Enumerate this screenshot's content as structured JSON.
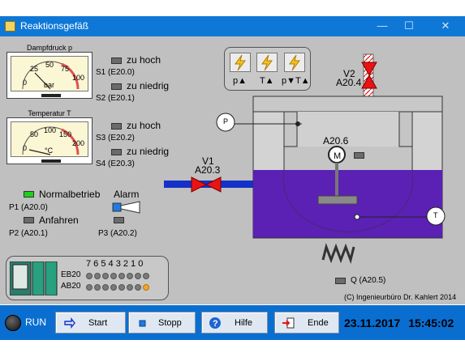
{
  "window": {
    "title": "Reaktionsgefäß",
    "controls": [
      "—",
      "☐",
      "✕"
    ]
  },
  "gauges": {
    "pressure": {
      "caption": "Dampfdruck p",
      "unit": "bar",
      "ticks": [
        "0",
        "25",
        "50",
        "75",
        "100"
      ]
    },
    "temperature": {
      "caption": "Temperatur T",
      "unit": "°C",
      "ticks": [
        "0",
        "50",
        "100",
        "150",
        "200"
      ]
    }
  },
  "switches": {
    "s1": {
      "label": "zu hoch",
      "addr": "S1 (E20.0)"
    },
    "s2": {
      "label": "zu niedrig",
      "addr": "S2 (E20.1)"
    },
    "s3": {
      "label": "zu hoch",
      "addr": "S3 (E20.2)"
    },
    "s4": {
      "label": "zu niedrig",
      "addr": "S4 (E20.3)"
    }
  },
  "status": {
    "normal": {
      "label": "Normalbetrieb",
      "addr": "P1 (A20.0)",
      "color": "#19d219"
    },
    "anfahren": {
      "label": "Anfahren",
      "addr": "P2 (A20.1)"
    },
    "alarm": {
      "label": "Alarm",
      "addr": "P3 (A20.2)"
    }
  },
  "plc": {
    "bit_header": "7 6 5 4 3 2 1 0",
    "rows": [
      {
        "label": "EB20",
        "bits": [
          0,
          0,
          0,
          0,
          0,
          0,
          0,
          0
        ]
      },
      {
        "label": "AB20",
        "bits": [
          0,
          0,
          0,
          0,
          0,
          0,
          0,
          1
        ]
      }
    ]
  },
  "process": {
    "control_labels": [
      "p▲",
      "T▲",
      "p▼T▲"
    ],
    "valve1": {
      "name": "V1",
      "addr": "A20.3"
    },
    "valve2": {
      "name": "V2",
      "addr": "A20.4"
    },
    "motor": {
      "symbol": "M",
      "addr": "A20.6"
    },
    "heater": {
      "addr": "Q (A20.5)"
    },
    "sensor_p": "P",
    "sensor_t": "T",
    "copyright": "(C) Ingenieurbüro Dr. Kahlert 2014",
    "colors": {
      "liquid": "#5b20b4",
      "pipe": "#1431c8",
      "valve": "#e81414"
    }
  },
  "toolbar": {
    "run_label": "RUN",
    "start": "Start",
    "stop": "Stopp",
    "help": "Hilfe",
    "end": "Ende"
  },
  "datetime": {
    "date": "23.11.2017",
    "time": "15:45:02"
  }
}
